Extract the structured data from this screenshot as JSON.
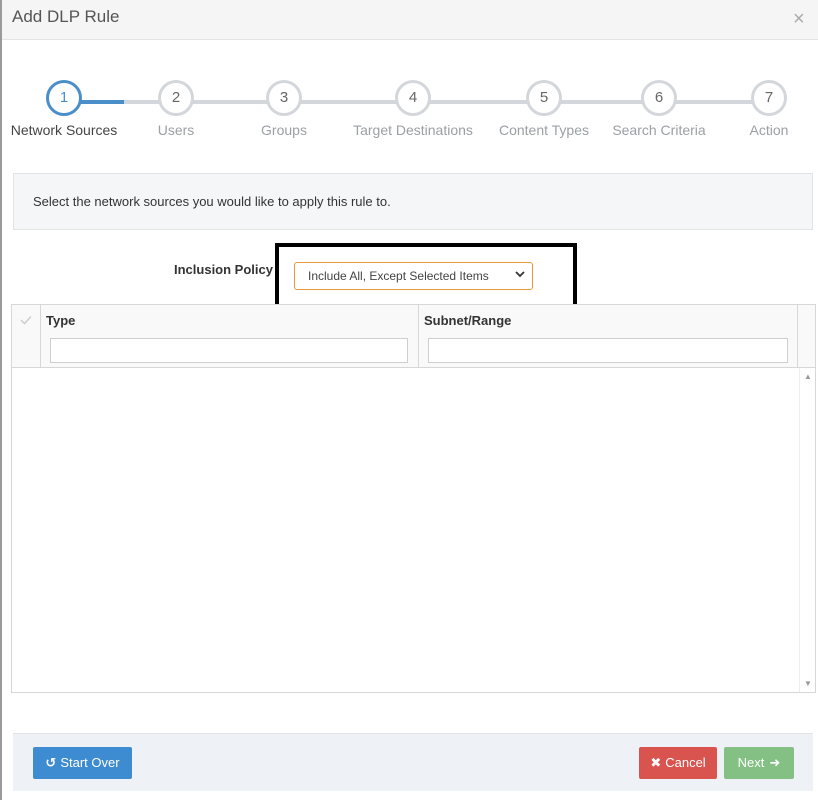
{
  "dialog": {
    "title": "Add DLP Rule",
    "close_glyph": "×"
  },
  "wizard": {
    "steps": [
      {
        "num": "1",
        "label": "Network Sources"
      },
      {
        "num": "2",
        "label": "Users"
      },
      {
        "num": "3",
        "label": "Groups"
      },
      {
        "num": "4",
        "label": "Target Destinations"
      },
      {
        "num": "5",
        "label": "Content Types"
      },
      {
        "num": "6",
        "label": "Search Criteria"
      },
      {
        "num": "7",
        "label": "Action"
      }
    ]
  },
  "info": {
    "text": "Select the network sources you would like to apply this rule to."
  },
  "inclusion": {
    "label": "Inclusion Policy",
    "selected": "Include All, Except Selected Items"
  },
  "grid": {
    "columns": [
      {
        "label": "Type"
      },
      {
        "label": "Subnet/Range"
      }
    ],
    "filters": {
      "type_value": "",
      "subnet_value": ""
    }
  },
  "footer": {
    "start_over": "Start Over",
    "cancel": "Cancel",
    "next": "Next"
  },
  "icons": {
    "close": "close-icon",
    "start_over": "undo-icon",
    "cancel": "times-icon",
    "next": "arrow-right-icon"
  },
  "colors": {
    "accent": "#4a8fc9",
    "cancel": "#d9534f",
    "next": "#84c084",
    "select_border": "#e79a3c"
  }
}
